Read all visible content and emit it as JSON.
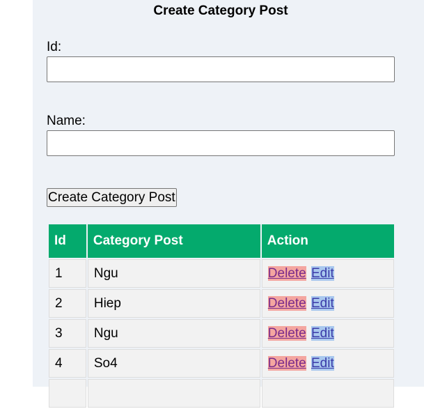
{
  "form": {
    "title": "Create Category Post",
    "id_label": "Id:",
    "id_value": "",
    "name_label": "Name:",
    "name_value": "",
    "submit_label": "Create Category Post"
  },
  "table": {
    "headers": [
      "Id",
      "Category Post",
      "Action"
    ],
    "rows": [
      {
        "id": "1",
        "name": "Ngu",
        "delete": "Delete",
        "edit": "Edit"
      },
      {
        "id": "2",
        "name": "Hiep",
        "delete": "Delete",
        "edit": "Edit"
      },
      {
        "id": "3",
        "name": "Ngu",
        "delete": "Delete",
        "edit": "Edit"
      },
      {
        "id": "4",
        "name": "So4",
        "delete": "Delete",
        "edit": "Edit"
      }
    ]
  },
  "colors": {
    "header_bg": "#04aa6d",
    "panel_bg": "#eef2f7",
    "delete_bg": "#f4a6a0",
    "edit_bg": "#a9c8ee"
  }
}
